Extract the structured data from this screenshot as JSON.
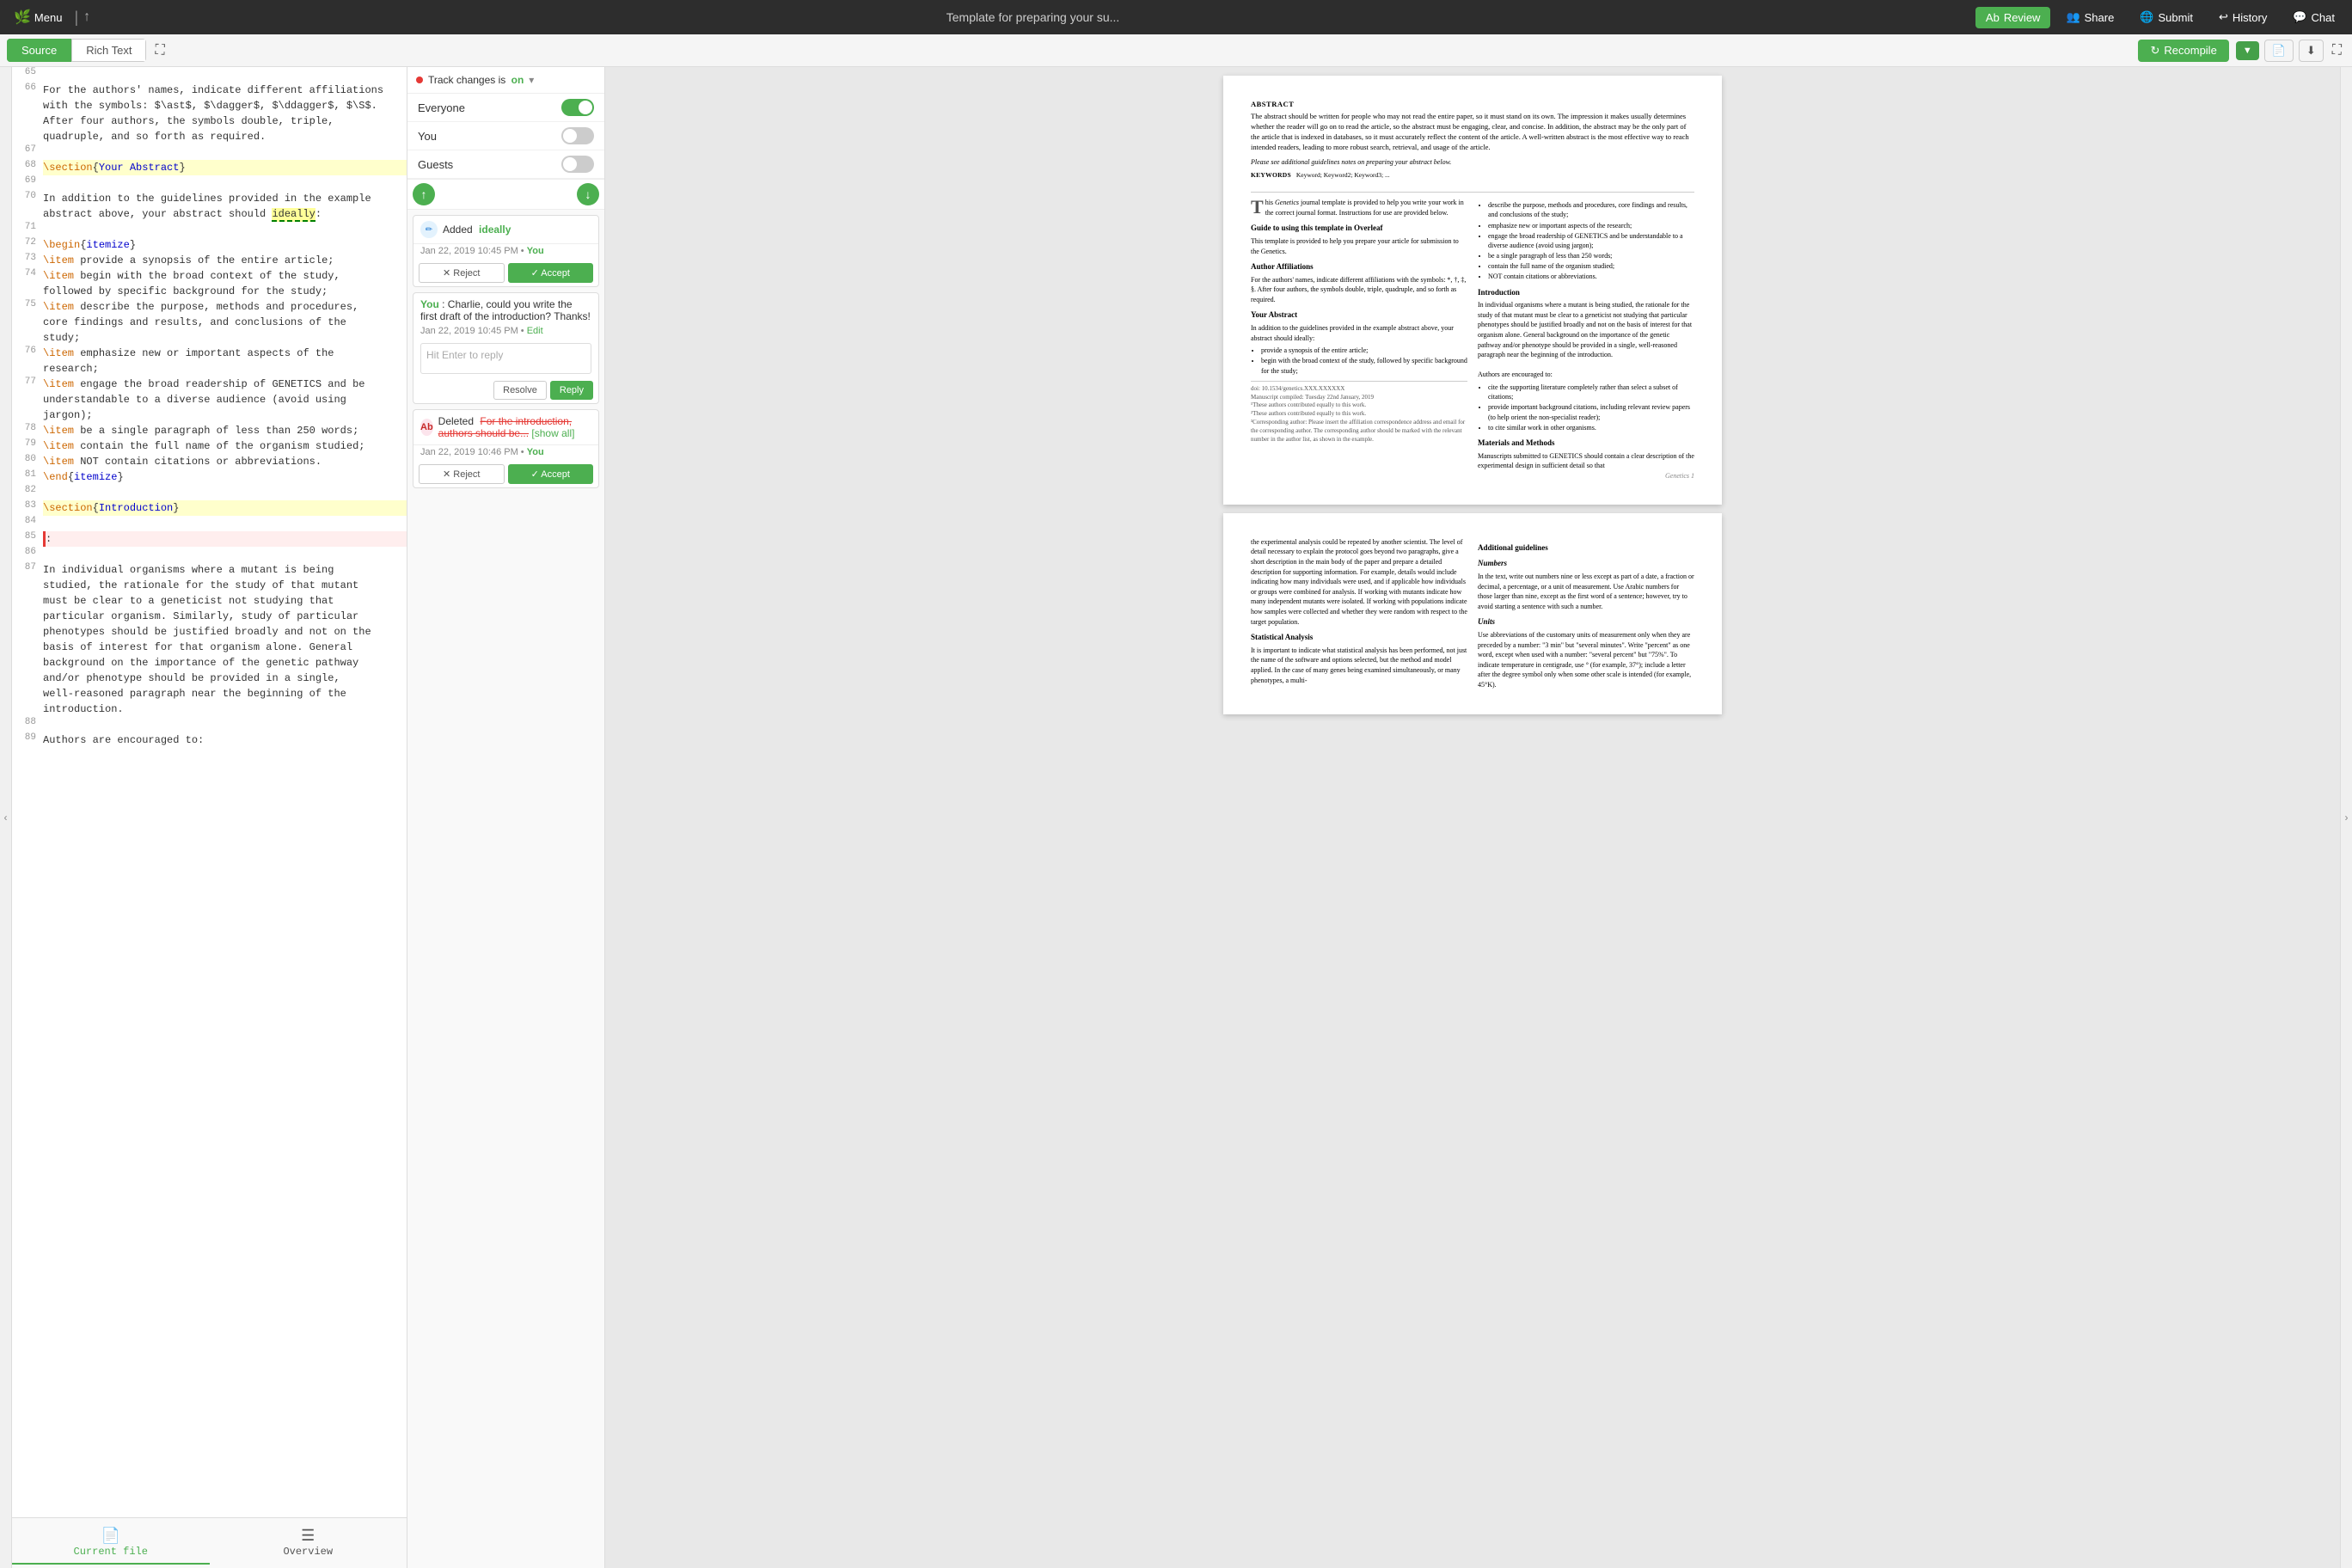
{
  "topNav": {
    "menu": "Menu",
    "title": "Template for preparing your su...",
    "review": "Review",
    "share": "Share",
    "submit": "Submit",
    "history": "History",
    "chat": "Chat"
  },
  "toolbar": {
    "source": "Source",
    "richText": "Rich Text",
    "recompile": "Recompile",
    "fullscreen": "⛶"
  },
  "editor": {
    "lines": [
      {
        "num": "65",
        "text": ""
      },
      {
        "num": "66",
        "text": "For the authors' names, indicate different affiliations\nwith the symbols: $\\ast$, $\\dagger$, $\\ddagger$, $\\S$.\nAfter four authors, the symbols double, triple,\nquadruple, and so forth as required."
      },
      {
        "num": "67",
        "text": ""
      },
      {
        "num": "68",
        "text": "\\section{Your Abstract}",
        "highlight": "yellow"
      },
      {
        "num": "69",
        "text": ""
      },
      {
        "num": "70",
        "text": "In addition to the guidelines provided in the example\nabstract above, your abstract should ideally:"
      },
      {
        "num": "71",
        "text": ""
      },
      {
        "num": "72",
        "text": "\\begin{itemize}"
      },
      {
        "num": "73",
        "text": "\\item provide a synopsis of the entire article;"
      },
      {
        "num": "74",
        "text": "\\item begin with the broad context of the study,\nfollowed by specific background for the study;"
      },
      {
        "num": "75",
        "text": "\\item describe the purpose, methods and procedures,\ncore findings and results, and conclusions of the\nstudy;"
      },
      {
        "num": "76",
        "text": "\\item emphasize new or important aspects of the\nresearch;"
      },
      {
        "num": "77",
        "text": "\\item engage the broad readership of GENETICS and be\nunderstandable to a diverse audience (avoid using\njargon);"
      },
      {
        "num": "78",
        "text": "\\item be a single paragraph of less than 250 words;"
      },
      {
        "num": "79",
        "text": "\\item contain the full name of the organism studied;"
      },
      {
        "num": "80",
        "text": "\\item NOT contain citations or abbreviations."
      },
      {
        "num": "81",
        "text": "\\end{itemize}"
      },
      {
        "num": "82",
        "text": ""
      },
      {
        "num": "83",
        "text": "\\section{Introduction}",
        "highlight": "yellow"
      },
      {
        "num": "84",
        "text": ""
      },
      {
        "num": "85",
        "text": ":",
        "highlight": "red"
      },
      {
        "num": "86",
        "text": ""
      },
      {
        "num": "87",
        "text": "In individual organisms where a mutant is being\nstudied, the rationale for the study of that mutant\nmust be clear to a geneticist not studying that\nparticular organism. Similarly, study of particular\nphenotypes should be justified broadly and not on the\nbasis of interest for that organism alone. General\nbackground on the importance of the genetic pathway\nand/or phenotype should be provided in a single,\nwell-reasoned paragraph near the beginning of the\nintroduction."
      },
      {
        "num": "88",
        "text": ""
      },
      {
        "num": "89",
        "text": "Authors are encouraged to:"
      }
    ],
    "bottomTabs": [
      {
        "label": "Current file",
        "active": true
      },
      {
        "label": "Overview",
        "active": false
      }
    ]
  },
  "trackChanges": {
    "label": "Track changes is",
    "status": "on",
    "toggles": [
      {
        "label": "Everyone",
        "on": true
      },
      {
        "label": "You",
        "on": false
      },
      {
        "label": "Guests",
        "on": false
      }
    ]
  },
  "changes": [
    {
      "type": "added",
      "action": "Added",
      "word": "ideally",
      "date": "Jan 22, 2019 10:45 PM",
      "author": "You",
      "reject": "✕ Reject",
      "accept": "✓ Accept"
    }
  ],
  "comments": [
    {
      "author": "You",
      "text": "Charlie, could you write the first draft of the introduction? Thanks!",
      "date": "Jan 22, 2019 10:45 PM",
      "editLabel": "Edit",
      "replyPlaceholder": "Hit Enter to reply",
      "resolve": "Resolve",
      "reply": "Reply"
    }
  ],
  "deletedChange": {
    "type": "deleted",
    "action": "Deleted",
    "text": "For the introduction, authors should be...",
    "showAll": "[show all]",
    "date": "Jan 22, 2019 10:46 PM",
    "author": "You",
    "reject": "✕ Reject",
    "accept": "✓ Accept"
  },
  "preview": {
    "page1": {
      "abstractTitle": "ABSTRACT",
      "abstractText": "The abstract should be written for people who may not read the entire paper, so it must stand on its own. The impression it makes usually determines whether the reader will go on to read the article, so the abstract must be engaging, clear, and concise. In addition, the abstract may be the only part of the article that is indexed in databases, so it must accurately reflect the content of the article. A well-written abstract is the most effective way to reach intended readers, leading to more robust search, retrieval, and usage of the article.",
      "guidelinesLabel": "Please see additional guidelines notes on preparing your abstract below.",
      "keywordsLabel": "KEYWORDS",
      "keywords": "Keyword; Keyword2; Keyword3; ...",
      "dropCapLetter": "T",
      "dropCapText": "his Genetics journal template is provided to help you write your work in the correct journal format. Instructions for use are provided below.",
      "bulletPoints": [
        "describe the purpose, methods and procedures, core findings and results, and conclusions of the study;",
        "emphasize new or important aspects of the research;",
        "engage the broad readership of GENETICS and be understandable to a diverse audience (avoid using jargon);",
        "be a single paragraph of less than 250 words;",
        "contain the full name of the organism studied;",
        "NOT contain citations or abbreviations."
      ],
      "guideTitle": "Guide to using this template in Overleaf",
      "guideText": "This template is provided to help you prepare your article for submission to the Genetics.",
      "affiliationsTitle": "Author Affiliations",
      "affiliationsText": "For the authors' names, indicate different affiliations with the symbols: *, †, ‡, §. After four authors, the symbols double, triple, quadruple, and so forth as required.",
      "abstractSectionTitle": "Your Abstract",
      "abstractSectionText": "In addition to the guidelines provided in the example abstract above, your abstract should ideally:",
      "abstractList": [
        "provide a synopsis of the entire article;",
        "begin with the broad context of the study, followed by specific background for the study;"
      ],
      "introTitle": "Introduction",
      "introText": "In individual organisms where a mutant is being studied, the rationale for the study of that mutant must be clear to a geneticist not studying that particular phenotypes should be justified broadly and not on the basis of interest for that organism alone. General background on the importance of the genetic pathway and/or phenotype should be provided in a single, well-reasoned paragraph near the beginning of the introduction.\n\nAuthors are encouraged to:",
      "introBullets": [
        "cite the supporting literature completely rather than select a subset of citations;",
        "provide important background citations, including relevant review papers (to help orient the non-specialist reader);",
        "to cite similar work in other organisms."
      ],
      "materialsTitle": "Materials and Methods",
      "materialsText": "Manuscripts submitted to GENETICS should contain a clear description of the experimental design in sufficient detail so that",
      "doi": "doi: 10.1534/genetics.XXX.XXXXXX",
      "manuscriptDate": "Manuscript compiled: Tuesday 22nd January, 2019",
      "footnote1": "¹These authors contributed equally to this work.",
      "footnote2": "²These authors contributed equally to this work.",
      "footnote3": "³Corresponding author: Please insert the affiliation correspondence address and email for the corresponding author. The corresponding author should be marked with the relevant number in the author list, as shown in the example.",
      "pageNum": "Genetics 1"
    },
    "page2": {
      "text": "the experimental analysis could be repeated by another scientist. The level of detail necessary to explain the protocol goes beyond two paragraphs, give a short description in the main body of the paper and prepare a detailed description for supporting information. For example, details would include indicating how many individuals were used, and if applicable how individuals or groups were combined for analysis. If working with mutants indicate how many independent mutants were isolated. If working with populations indicate how samples were collected and whether they were random with respect to the target population.",
      "additionalTitle": "Additional guidelines",
      "numbersTitle": "Numbers",
      "numbersText": "In the text, write out numbers nine or less except as part of a date, a fraction or decimal, a percentage, or a unit of measurement. Use Arabic numbers for those larger than nine, except as the first word of a sentence; however, try to avoid starting a sentence with such a number.",
      "unitsTitle": "Units",
      "unitsText": "Use abbreviations of the customary units of measurement only when they are preceded by a number: \"3 min\" but \"several minutes\". Write \"percent\" as one word, except when used with a number: \"several percent\" but \"75%\". To indicate temperature in centigrade, use ° (for example, 37°); include a letter after the degree symbol only when some other scale is intended (for example, 45°K).",
      "statisticalTitle": "Statistical Analysis",
      "statisticalText": "It is important to indicate what statistical analysis has been performed, not just the name of the software and options selected, but the method and model applied. In the case of many genes being examined simultaneously, or many phenotypes, a multi-"
    }
  }
}
